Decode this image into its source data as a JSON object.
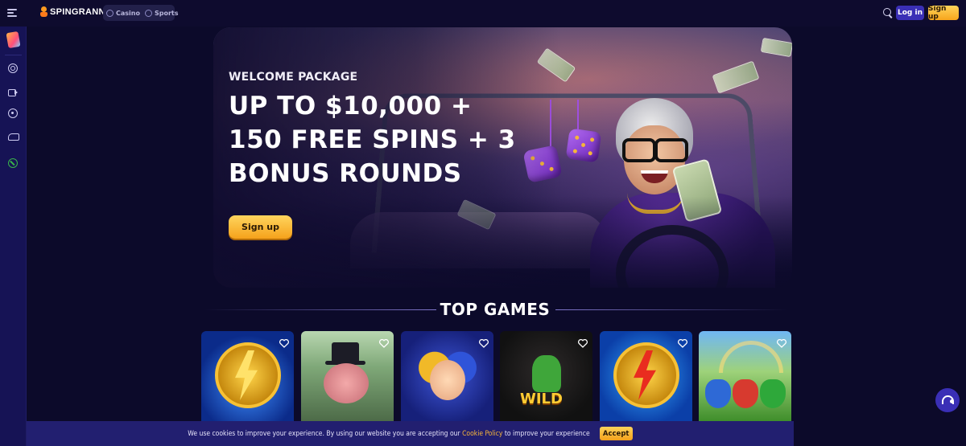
{
  "header": {
    "logo_text": "SPINGRANNY",
    "modes": [
      {
        "label": "Casino",
        "icon": "casino-chip-icon"
      },
      {
        "label": "Sports",
        "icon": "soccer-ball-icon"
      }
    ],
    "login_label": "Log in",
    "signup_label": "Sign up"
  },
  "sidebar": {
    "items": [
      {
        "icon": "promotions-icon"
      },
      {
        "icon": "casino-chip-icon"
      },
      {
        "icon": "live-camera-icon"
      },
      {
        "icon": "soccer-ball-icon"
      },
      {
        "icon": "virtual-sports-icon"
      },
      {
        "icon": "esports-icon"
      }
    ]
  },
  "hero": {
    "kicker": "WELCOME PACKAGE",
    "title": "UP TO $10,000 + 150 FREE SPINS + 3 BONUS ROUNDS",
    "cta_label": "Sign up"
  },
  "top_games": {
    "title": "TOP GAMES",
    "games": [
      {
        "art": "golden-lightning-coin"
      },
      {
        "art": "pig-in-top-hat"
      },
      {
        "art": "jester-with-dice"
      },
      {
        "art": "wild-cactus-cowboy"
      },
      {
        "art": "red-lightning-coin"
      },
      {
        "art": "pots-of-gold"
      }
    ]
  },
  "cookie_banner": {
    "text_before": "We use cookies to improve your experience. By using our website you are accepting our",
    "link_label": "Cookie Policy",
    "text_after": "to improve your experience",
    "accept_label": "Accept"
  },
  "colors": {
    "background": "#0c0a2a",
    "sidebar": "#161355",
    "accent_yellow": "#f7a51c",
    "login_purple": "#3a2fb6",
    "cookie_bar": "#221f70"
  }
}
